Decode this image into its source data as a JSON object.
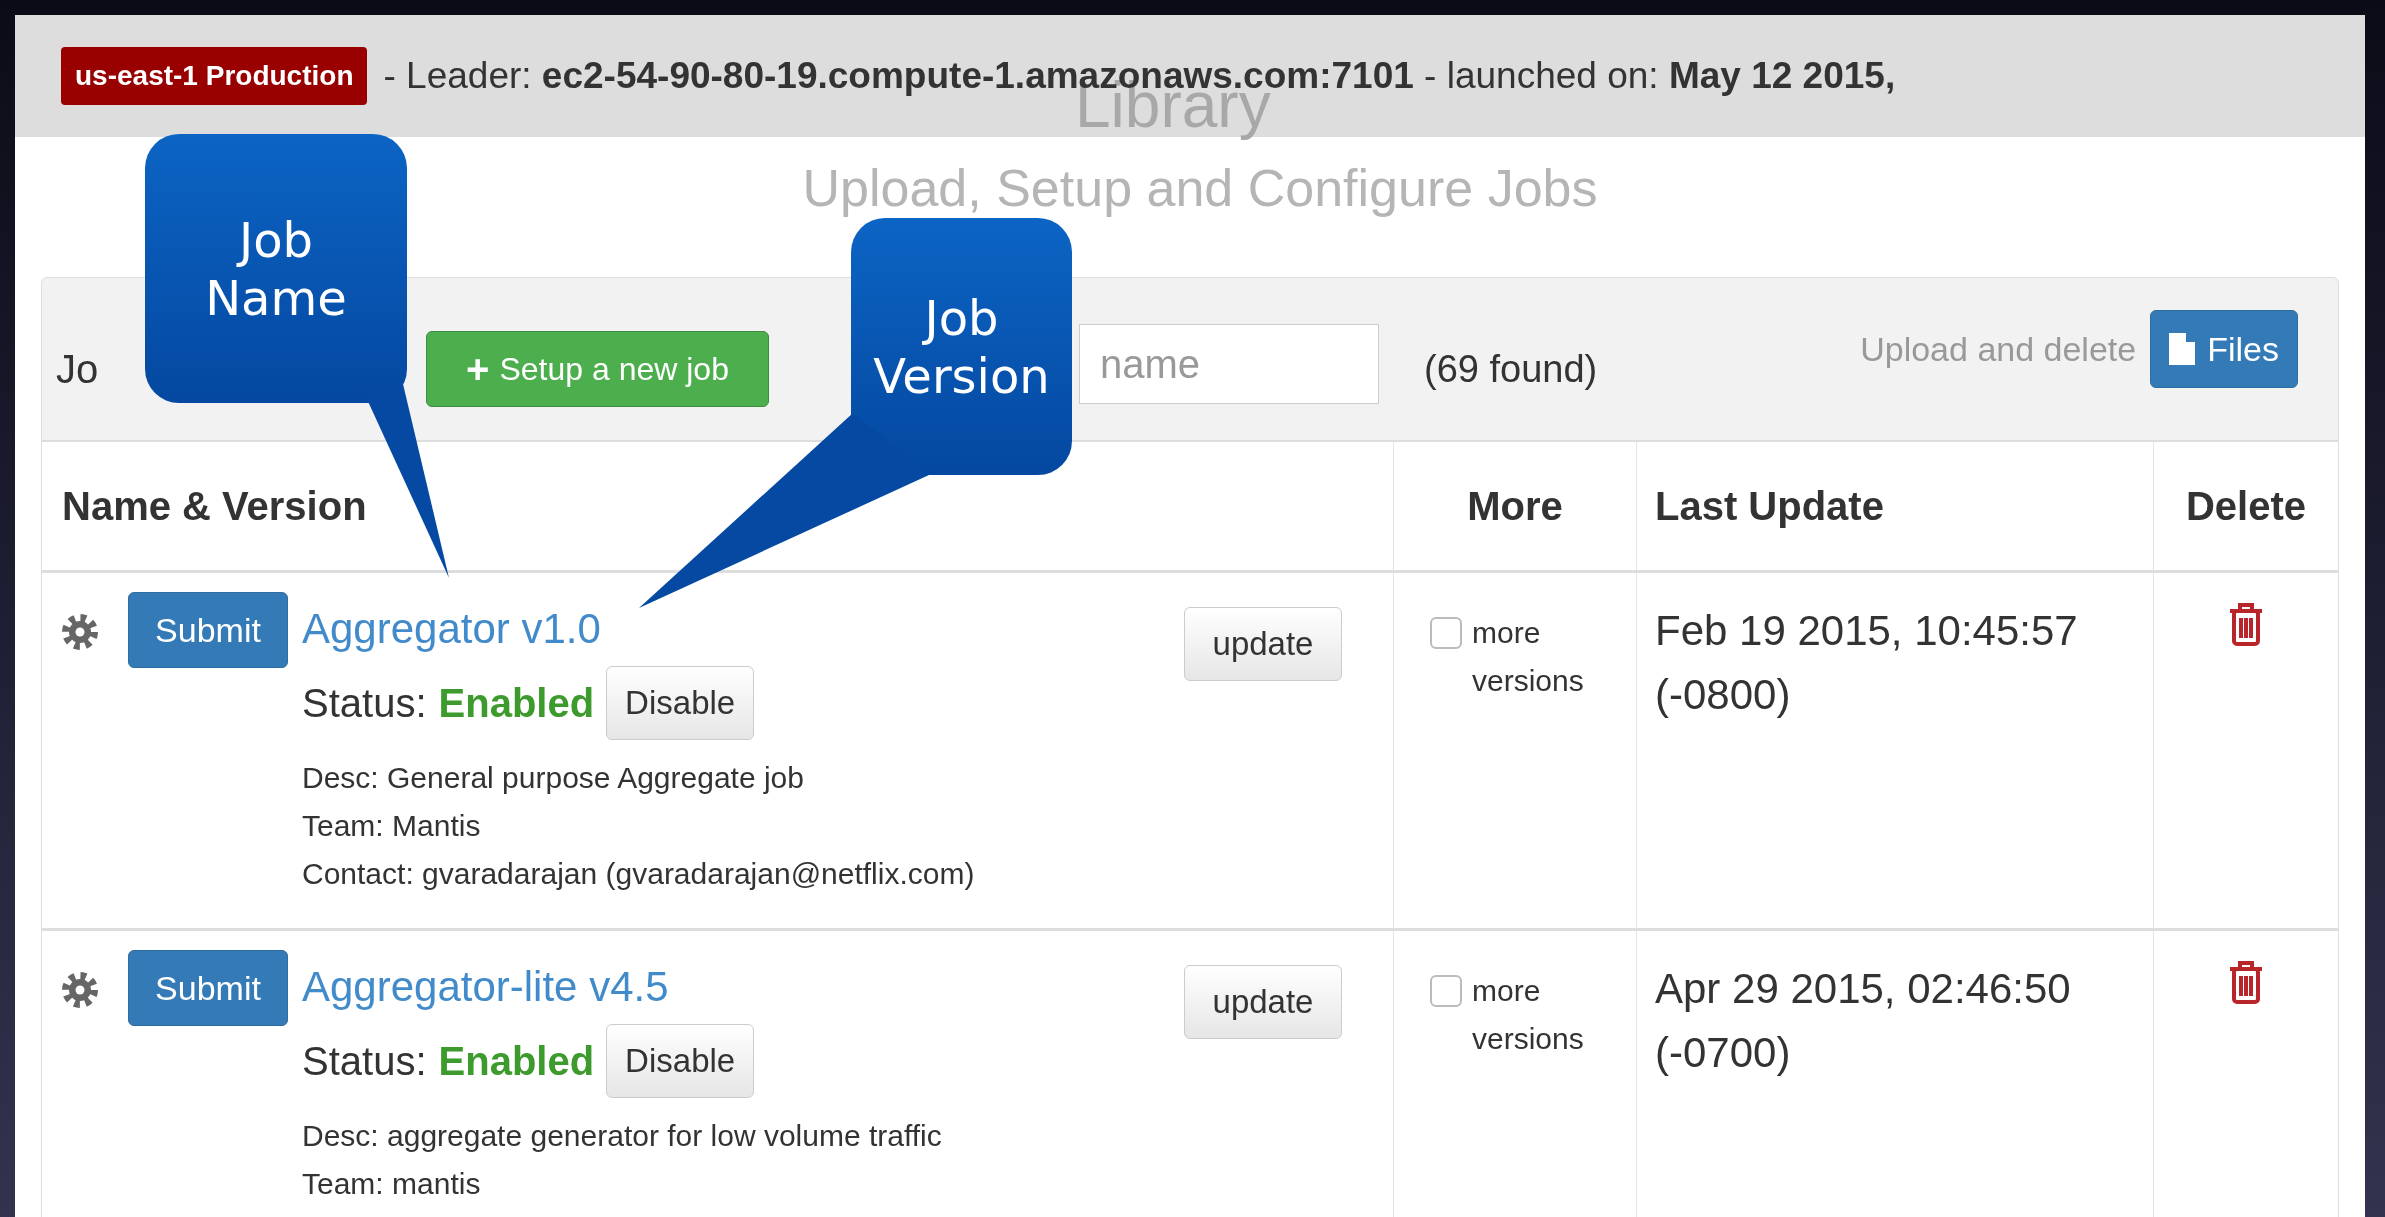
{
  "header": {
    "environment_badge": "us-east-1 Production",
    "leader_line": "- Leader: **ec2-54-90-80-19.compute-1.amazonaws.com:7101** - launched on: **May 12 2015,**",
    "background_title": "Library"
  },
  "page_title": "Upload, Setup and Configure Jobs",
  "toolbar": {
    "label": "Jo",
    "new_job_button": "Setup a new job",
    "new_job_icon": "+",
    "search": {
      "placeholder": "name"
    },
    "found_count": "(69 found)",
    "upload_label": "Upload and delete",
    "files_button": "Files"
  },
  "table": {
    "columns": [
      "Name & Version",
      "More",
      "Last Update",
      "Delete"
    ],
    "rows": [
      {
        "submit_button": "Submit",
        "name": "Aggregator v1.0",
        "status_label": "Status:",
        "status": "Enabled",
        "toggle_button": "Disable",
        "details": [
          "Desc: General purpose Aggregate job",
          "Team: Mantis",
          "Contact: gvaradarajan (gvaradarajan@netflix.com)"
        ],
        "update_button": "update",
        "more_checked": false,
        "more_label": "more versions",
        "last_update": "Feb 19 2015, 10:45:57 (-0800)"
      },
      {
        "submit_button": "Submit",
        "name": "Aggregator-lite v4.5",
        "status_label": "Status:",
        "status": "Enabled",
        "toggle_button": "Disable",
        "details": [
          "Desc: aggregate generator for low volume traffic",
          "Team: mantis"
        ],
        "update_button": "update",
        "more_checked": false,
        "more_label": "more versions",
        "last_update": "Apr 29 2015, 02:46:50 (-0700)"
      }
    ]
  },
  "callouts": [
    {
      "label": "Job Name"
    },
    {
      "label": "Job Version"
    }
  ]
}
